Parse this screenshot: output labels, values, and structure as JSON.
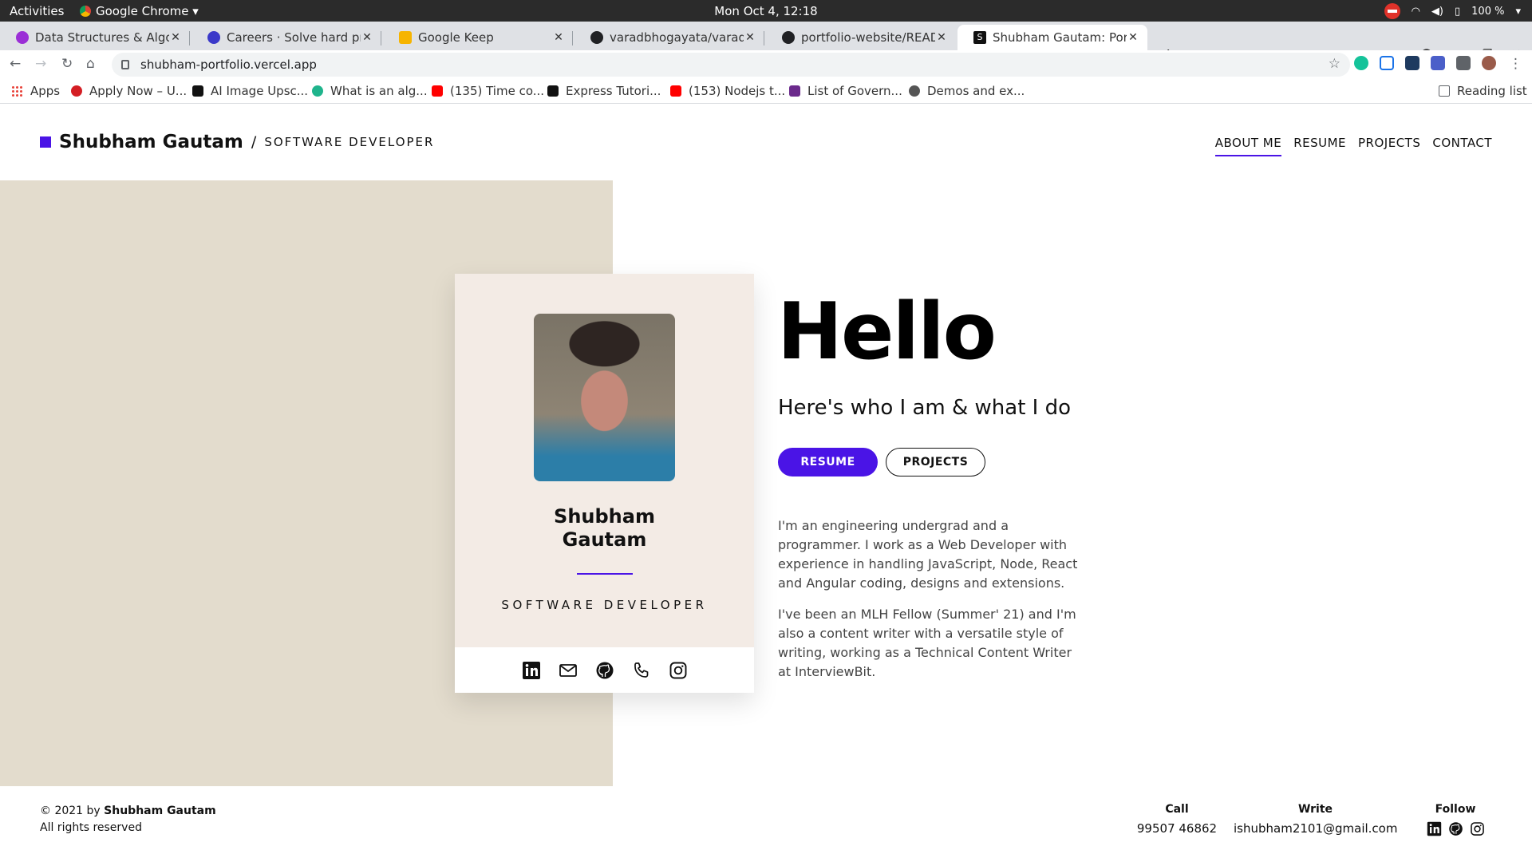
{
  "os_bar": {
    "activities": "Activities",
    "app_name": "Google Chrome",
    "clock": "Mon Oct  4, 12:18",
    "battery": "100 %"
  },
  "tabs": [
    {
      "title": "Data Structures & Algorithms",
      "favicon_color": "#9b2fd6"
    },
    {
      "title": "Careers · Solve hard problems",
      "favicon_color": "#3b39c9"
    },
    {
      "title": "Google Keep",
      "favicon_color": "#f6b400"
    },
    {
      "title": "varadbhogayata/varadbhogayata",
      "favicon_color": "#202124"
    },
    {
      "title": "portfolio-website/README.md",
      "favicon_color": "#202124"
    },
    {
      "title": "Shubham Gautam: Portfolio",
      "favicon_color": "#111111",
      "favicon_letter": "S"
    }
  ],
  "address": {
    "url": "shubham-portfolio.vercel.app"
  },
  "bookmarks": [
    {
      "label": "Apps"
    },
    {
      "label": "Apply Now – U...",
      "color": "#d41e24"
    },
    {
      "label": "AI Image Upsc...",
      "color": "#111111"
    },
    {
      "label": "What is an alg...",
      "color": "#1fb48c"
    },
    {
      "label": "(135) Time co...",
      "color": "#ff0000"
    },
    {
      "label": "Express Tutori...",
      "color": "#111111"
    },
    {
      "label": "(153) Nodejs t...",
      "color": "#ff0000"
    },
    {
      "label": "List of Govern...",
      "color": "#6b2a8c"
    },
    {
      "label": "Demos and ex...",
      "color": "#555555"
    },
    {
      "label": "Reading list"
    }
  ],
  "site": {
    "brand_name": "Shubham Gautam",
    "brand_slash": "/",
    "brand_role": "SOFTWARE DEVELOPER",
    "nav": [
      "ABOUT ME",
      "RESUME",
      "PROJECTS",
      "CONTACT"
    ],
    "accent": "#4a14e6",
    "beige": "#e3dccd"
  },
  "card": {
    "name": "Shubham Gautam",
    "role": "SOFTWARE DEVELOPER",
    "socials": [
      "linkedin-icon",
      "mail-icon",
      "github-icon",
      "phone-icon",
      "instagram-icon"
    ]
  },
  "hero": {
    "hello": "Hello",
    "subtitle": "Here's who I am & what I do",
    "btn_resume": "RESUME",
    "btn_projects": "PROJECTS",
    "para1": "I'm an engineering undergrad and a programmer. I work as a Web Developer with experience in handling JavaScript, Node, React and Angular coding, designs and extensions.",
    "para2": "I've been an MLH Fellow (Summer' 21) and I'm also a content writer with a versatile style of writing, working as a Technical Content Writer at InterviewBit."
  },
  "footer": {
    "copyright_prefix": "© 2021 by",
    "copyright_name": "Shubham Gautam",
    "rights": "All rights reserved",
    "call_label": "Call",
    "call_value": "99507 46862",
    "write_label": "Write",
    "write_value": "ishubham2101@gmail.com",
    "follow_label": "Follow"
  }
}
